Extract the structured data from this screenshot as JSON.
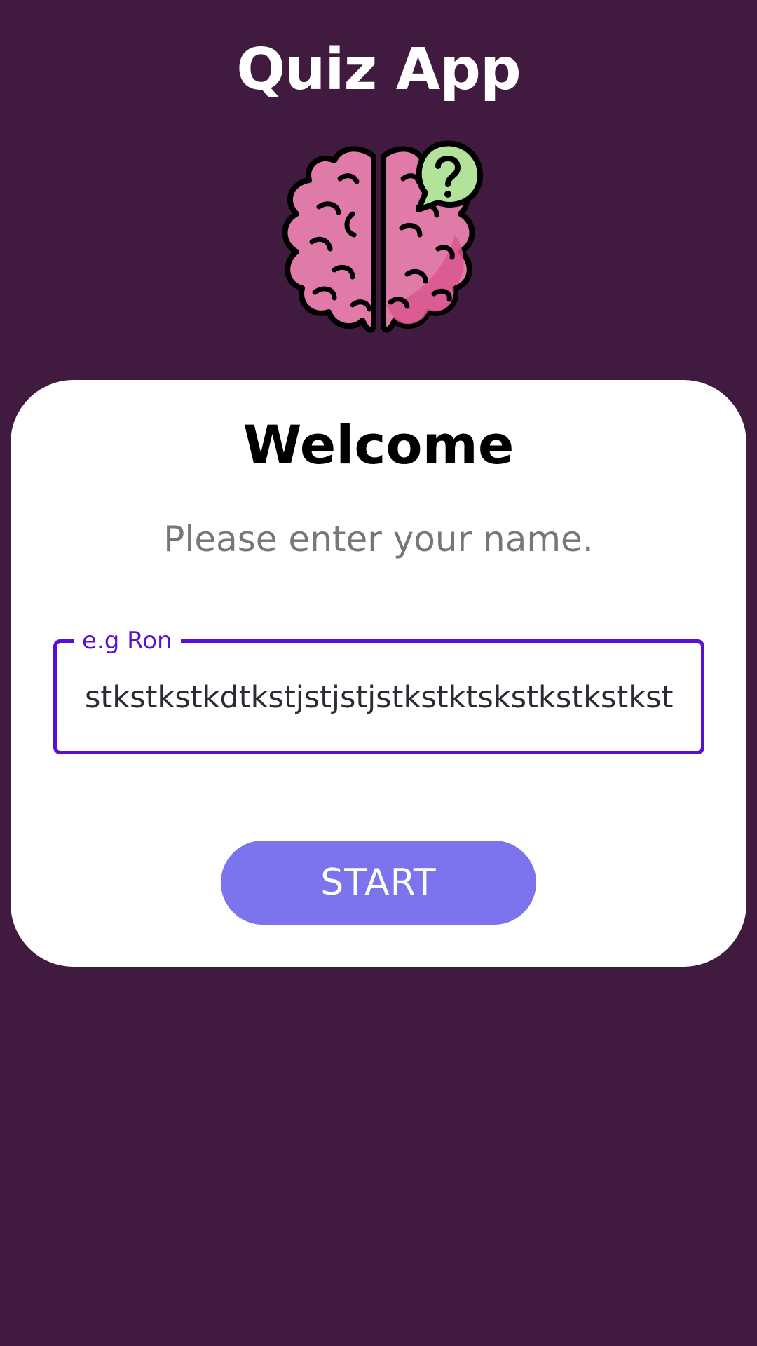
{
  "app": {
    "title": "Quiz App",
    "logo_icon": "brain-question-icon",
    "background_color": "#411a3f"
  },
  "card": {
    "heading": "Welcome",
    "prompt": "Please enter your name.",
    "name_field": {
      "label": "e.g Ron",
      "value": "stkstkstkdtkstjstjstjstkstktskstkstkstkst",
      "accent_color": "#5a0fd6"
    },
    "start_button": {
      "label": "START",
      "color": "#7c74ec"
    }
  }
}
